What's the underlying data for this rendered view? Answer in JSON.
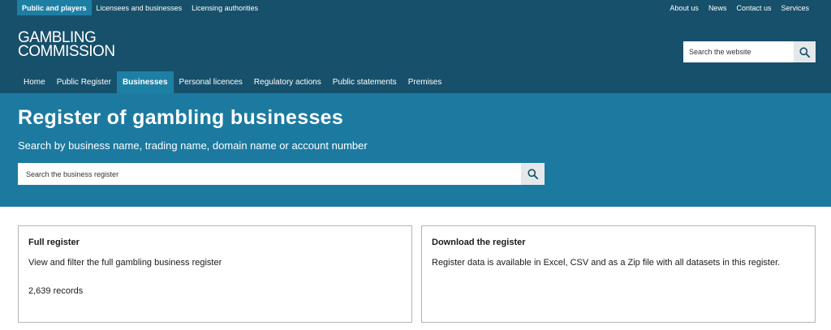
{
  "topbar": {
    "left": [
      "Public and players",
      "Licensees and businesses",
      "Licensing authorities"
    ],
    "right": [
      "About us",
      "News",
      "Contact us",
      "Services"
    ]
  },
  "header": {
    "logo_line1": "GAMBLING",
    "logo_line2": "COMMISSION",
    "search_placeholder": "Search the website"
  },
  "nav": [
    "Home",
    "Public Register",
    "Businesses",
    "Personal licences",
    "Regulatory actions",
    "Public statements",
    "Premises"
  ],
  "hero": {
    "title": "Register of gambling businesses",
    "subtitle": "Search by business name, trading name, domain name or account number",
    "search_placeholder": "Search the business register"
  },
  "cards": {
    "full_register": {
      "title": "Full register",
      "description": "View and filter the full gambling business register",
      "records": "2,639 records"
    },
    "download": {
      "title": "Download the register",
      "description": "Register data is available in Excel, CSV and as a Zip file with all datasets in this register."
    }
  },
  "icons": {
    "search": "search-icon"
  },
  "colors": {
    "header_bg": "#17506b",
    "hero_bg": "#1c7aa0",
    "active_tab": "#1e7fa4"
  }
}
